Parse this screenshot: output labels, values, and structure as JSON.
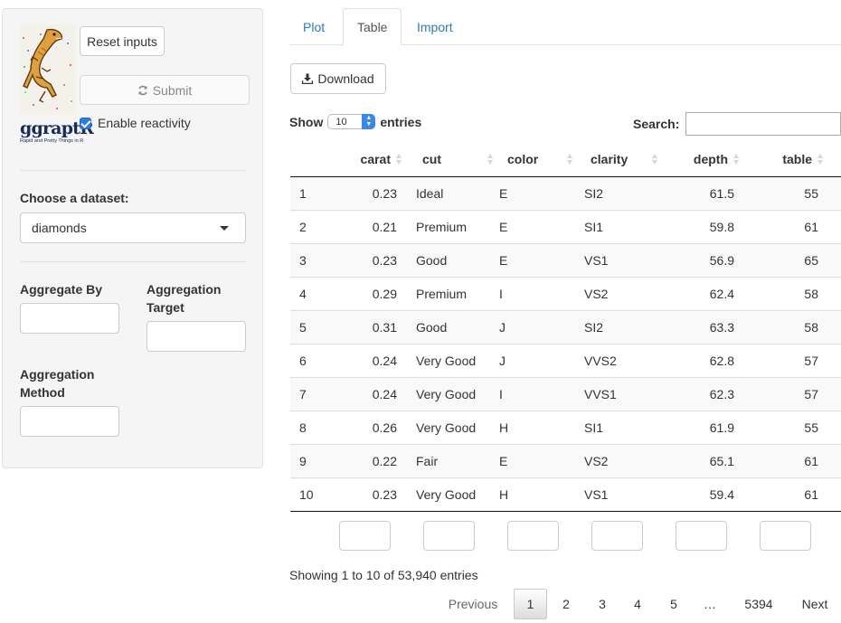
{
  "logo": {
    "name": "ggraptR",
    "tagline": "Rapid and Pretty Things in R"
  },
  "sidebar": {
    "reset_label": "Reset inputs",
    "submit_label": "Submit",
    "reactivity_label": "Enable reactivity",
    "reactivity_checked": true,
    "dataset_label": "Choose a dataset:",
    "dataset_value": "diamonds",
    "aggregate_by_label": "Aggregate By",
    "aggregation_target_label": "Aggregation Target",
    "aggregation_method_label": "Aggregation Method"
  },
  "tabs": [
    {
      "label": "Plot",
      "active": false
    },
    {
      "label": "Table",
      "active": true
    },
    {
      "label": "Import",
      "active": false
    }
  ],
  "download_label": "Download",
  "table": {
    "show_label": "Show",
    "page_length": "10",
    "entries_label": "entries",
    "search_label": "Search:",
    "columns": [
      "",
      "carat",
      "cut",
      "color",
      "clarity",
      "depth",
      "table"
    ],
    "rows": [
      [
        "1",
        "0.23",
        "Ideal",
        "E",
        "SI2",
        "61.5",
        "55"
      ],
      [
        "2",
        "0.21",
        "Premium",
        "E",
        "SI1",
        "59.8",
        "61"
      ],
      [
        "3",
        "0.23",
        "Good",
        "E",
        "VS1",
        "56.9",
        "65"
      ],
      [
        "4",
        "0.29",
        "Premium",
        "I",
        "VS2",
        "62.4",
        "58"
      ],
      [
        "5",
        "0.31",
        "Good",
        "J",
        "SI2",
        "63.3",
        "58"
      ],
      [
        "6",
        "0.24",
        "Very Good",
        "J",
        "VVS2",
        "62.8",
        "57"
      ],
      [
        "7",
        "0.24",
        "Very Good",
        "I",
        "VVS1",
        "62.3",
        "57"
      ],
      [
        "8",
        "0.26",
        "Very Good",
        "H",
        "SI1",
        "61.9",
        "55"
      ],
      [
        "9",
        "0.22",
        "Fair",
        "E",
        "VS2",
        "65.1",
        "61"
      ],
      [
        "10",
        "0.23",
        "Very Good",
        "H",
        "VS1",
        "59.4",
        "61"
      ]
    ],
    "info": "Showing 1 to 10 of 53,940 entries"
  },
  "pagination": {
    "previous": "Previous",
    "pages": [
      "1",
      "2",
      "3",
      "4",
      "5"
    ],
    "ellipsis": "…",
    "last": "5394",
    "next": "Next",
    "current": "1"
  },
  "colors": {
    "link": "#337ab7",
    "checkbox": "#2c7be5",
    "sidebar_bg": "#f5f5f5"
  }
}
